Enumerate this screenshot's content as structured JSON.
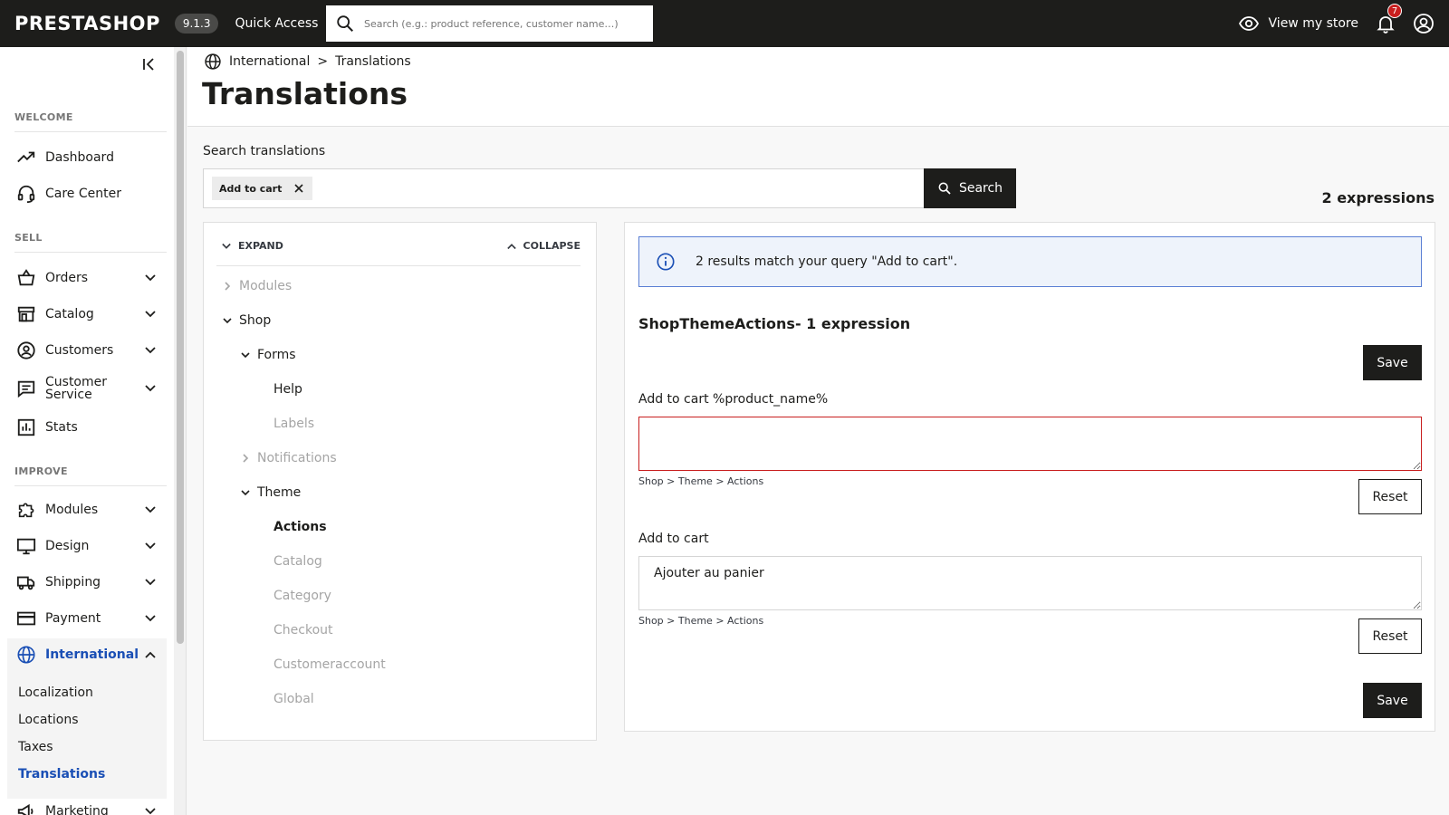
{
  "topbar": {
    "logo": "PRESTASHOP",
    "version": "9.1.3",
    "quick_access": "Quick Access",
    "search_placeholder": "Search (e.g.: product reference, customer name…)",
    "view_store": "View my store",
    "notification_count": "7"
  },
  "sidebar": {
    "sections": {
      "welcome": "WELCOME",
      "sell": "SELL",
      "improve": "IMPROVE"
    },
    "items": {
      "dashboard": "Dashboard",
      "care_center": "Care Center",
      "orders": "Orders",
      "catalog": "Catalog",
      "customers": "Customers",
      "customer_service": "Customer Service",
      "stats": "Stats",
      "modules": "Modules",
      "design": "Design",
      "shipping": "Shipping",
      "payment": "Payment",
      "international": "International",
      "marketing": "Marketing"
    },
    "international_sub": {
      "localization": "Localization",
      "locations": "Locations",
      "taxes": "Taxes",
      "translations": "Translations"
    }
  },
  "header": {
    "breadcrumb_parent": "International",
    "breadcrumb_sep": ">",
    "breadcrumb_current": "Translations",
    "title": "Translations"
  },
  "search": {
    "label": "Search translations",
    "tag": "Add to cart",
    "button": "Search",
    "expressions_count": "2 expressions"
  },
  "tree": {
    "expand": "EXPAND",
    "collapse": "COLLAPSE",
    "nodes": {
      "modules": "Modules",
      "shop": "Shop",
      "forms": "Forms",
      "help": "Help",
      "labels": "Labels",
      "notifications": "Notifications",
      "theme": "Theme",
      "actions": "Actions",
      "catalog": "Catalog",
      "category": "Category",
      "checkout": "Checkout",
      "customeraccount": "Customeraccount",
      "global": "Global"
    }
  },
  "results": {
    "alert": "2 results match your query \"Add to cart\".",
    "domain_title": "ShopThemeActions- 1 expression",
    "save_label": "Save",
    "reset_label": "Reset",
    "expressions": [
      {
        "source": "Add to cart %product_name%",
        "value": "",
        "path": "Shop > Theme > Actions"
      },
      {
        "source": "Add to cart",
        "value": "Ajouter au panier",
        "path": "Shop > Theme > Actions"
      }
    ]
  },
  "colors": {
    "accent": "#1a4fb5",
    "dark": "#1d1d1b",
    "error": "#c81e1e",
    "info_bg": "#eef3fb"
  }
}
